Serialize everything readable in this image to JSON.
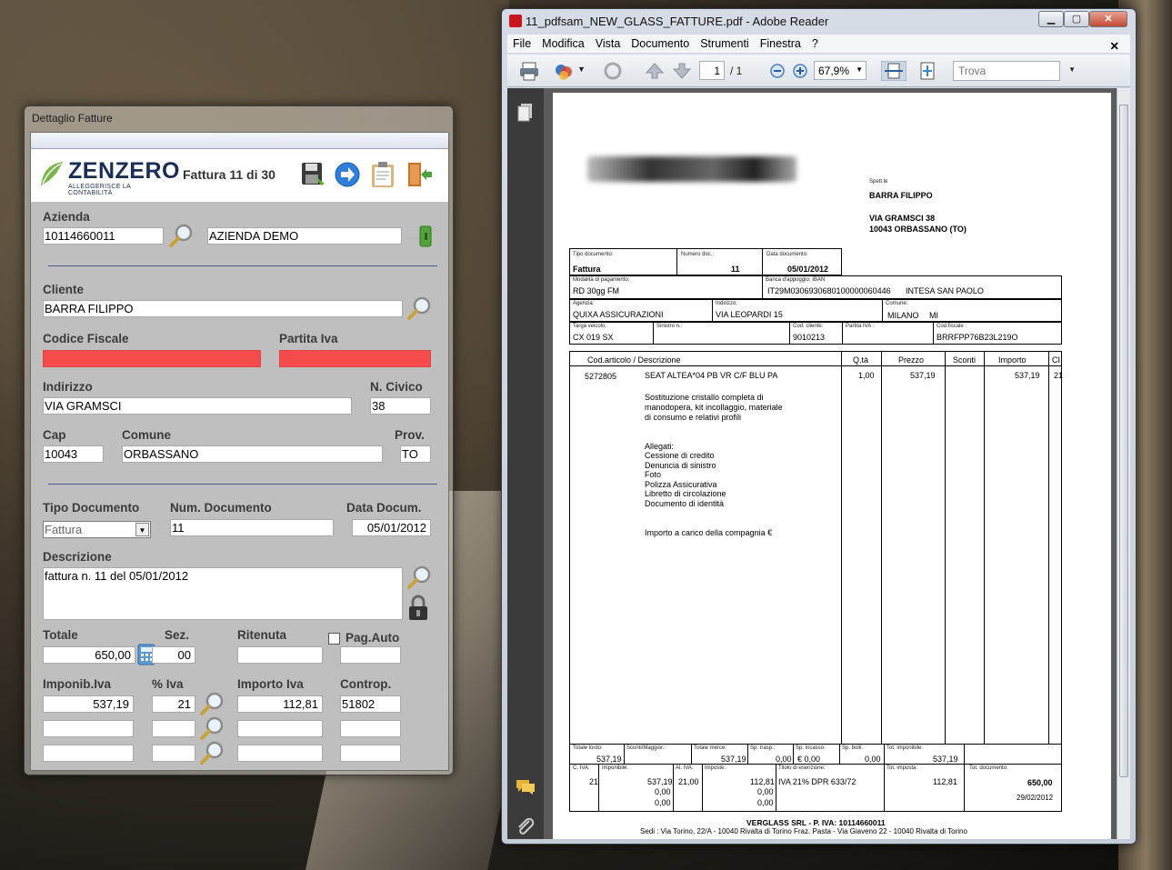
{
  "left_window": {
    "title": "Dettaglio Fatture",
    "logo": {
      "name": "ZENZERO",
      "tagline": "ALLEGGERISCE LA CONTABILITÀ"
    },
    "counter": "Fattura 11 di 30",
    "azienda": {
      "label": "Azienda",
      "code": "10114660011",
      "name": "AZIENDA DEMO"
    },
    "cliente": {
      "label": "Cliente",
      "value": "BARRA FILIPPO"
    },
    "codice_fiscale": {
      "label": "Codice Fiscale",
      "value": ""
    },
    "partita_iva": {
      "label": "Partita Iva",
      "value": ""
    },
    "indirizzo": {
      "label": "Indirizzo",
      "value": "VIA GRAMSCI"
    },
    "civico": {
      "label": "N. Civico",
      "value": "38"
    },
    "cap": {
      "label": "Cap",
      "value": "10043"
    },
    "comune": {
      "label": "Comune",
      "value": "ORBASSANO"
    },
    "prov": {
      "label": "Prov.",
      "value": "TO"
    },
    "tipo_documento": {
      "label": "Tipo Documento",
      "value": "Fattura"
    },
    "num_documento": {
      "label": "Num. Documento",
      "value": "11"
    },
    "data_documento": {
      "label": "Data Docum.",
      "value": "05/01/2012"
    },
    "descrizione": {
      "label": "Descrizione",
      "value": "fattura n. 11 del 05/01/2012"
    },
    "totale": {
      "label": "Totale",
      "value": "650,00"
    },
    "sez": {
      "label": "Sez.",
      "value": "00"
    },
    "ritenuta": {
      "label": "Ritenuta",
      "value": ""
    },
    "pag_auto": {
      "label": "Pag.Auto",
      "value": ""
    },
    "iva_headers": {
      "imponib": "Imponib.Iva",
      "perc": "% Iva",
      "importo": "Importo Iva",
      "controp": "Controp."
    },
    "iva_rows": [
      {
        "imponib": "537,19",
        "perc": "21",
        "importo": "112,81",
        "controp": "51802"
      },
      {
        "imponib": "",
        "perc": "",
        "importo": "",
        "controp": ""
      },
      {
        "imponib": "",
        "perc": "",
        "importo": "",
        "controp": ""
      }
    ]
  },
  "right_window": {
    "title": "11_pdfsam_NEW_GLASS_FATTURE.pdf - Adobe Reader",
    "menu": [
      "File",
      "Modifica",
      "Vista",
      "Documento",
      "Strumenti",
      "Finestra",
      "?"
    ],
    "page_current": "1",
    "page_total": "/ 1",
    "zoom": "67,9%",
    "find_placeholder": "Trova",
    "pdf": {
      "spett": "Spett.le",
      "dest_name": "BARRA FILIPPO",
      "dest_street": "VIA GRAMSCI 38",
      "dest_city": "10043 ORBASSANO (TO)",
      "tipo_doc_lbl": "Tipo documento:",
      "tipo_doc": "Fattura",
      "num_doc_lbl": "Numero doc.:",
      "num_doc": "11",
      "data_doc_lbl": "Data documento:",
      "data_doc": "05/01/2012",
      "mod_pag_lbl": "Modalità di pagamento:",
      "mod_pag": "RD 30gg FM",
      "banca_lbl": "Banca d'appoggio: IBAN",
      "iban": "IT29M0306930680100000060446",
      "banca": "INTESA SAN PAOLO",
      "agenzia_lbl": "Agenzia:",
      "agenzia": "QUIXA ASSICURAZIONI",
      "indirizzo_lbl": "Indirizzo:",
      "indirizzo": "VIA LEOPARDI 15",
      "comune_lbl": "Comune:",
      "comune": "MILANO",
      "prov": "MI",
      "targa_lbl": "Targa veicolo:",
      "targa": "CX 019 SX",
      "sinistro_lbl": "Sinistro n.:",
      "cod_cliente_lbl": "Cod. cliente:",
      "cod_cliente": "9010213",
      "piva_lbl": "Partita IVA :",
      "cf_lbl": "Cod.fiscale :",
      "cf": "BRRFPP76B23L219O",
      "cols": [
        "Cod.articolo / Descrizione",
        "Q.tà",
        "Prezzo",
        "Sconti",
        "Importo",
        "CI"
      ],
      "line_code": "5272805",
      "line_desc": "SEAT ALTEA*04 PB VR C/F BLU PA",
      "line_qty": "1,00",
      "line_price": "537,19",
      "line_amount": "537,19",
      "line_ci": "21",
      "desc_lines": [
        "Sostituzione cristallo completa di",
        "manodopera, kit incollaggio, materiale",
        "di consumo e relativi profili"
      ],
      "allegati": [
        "Allegati:",
        "Cessione di credito",
        "Denuncia di sinistro",
        "Foto",
        "Polizza Assicurativa",
        "Libretto di circolazione",
        "Documento di identità"
      ],
      "importo_note": "Importo a carico della compagnia €",
      "tot_lordo_lbl": "Totale lordo:",
      "tot_lordo": "537,19",
      "sconti_lbl": "Sconti/Maggior.:",
      "tot_merce_lbl": "Totale merce:",
      "tot_merce": "537,19",
      "sp_trasp_lbl": "Sp. trasp.:",
      "sp_trasp": "0,00",
      "sp_incasso_lbl": "Sp. incasso:",
      "sp_incasso": "€      0,00",
      "sp_bolli_lbl": "Sp. bolli:",
      "sp_bolli": "0,00",
      "tot_imponibile_lbl": "Tot. imponibile:",
      "tot_imponibile": "537,19",
      "c_iva_lbl": "C. IVA:",
      "c_iva": "21",
      "imponibile_lbl": "Imponibile:",
      "imponibili": [
        "537,19",
        "0,00",
        "0,00"
      ],
      "al_iva_lbl": "Al. IVA:",
      "al_iva": "21,00",
      "imposte_lbl": "Imposte:",
      "imposte": [
        "112,81",
        "0,00",
        "0,00"
      ],
      "esenzione_lbl": "Titolo di esenzione:",
      "esenzione": "IVA 21% DPR 633/72",
      "tot_imposta_lbl": "Tot. imposta:",
      "tot_imposta": "112,81",
      "tot_doc_lbl": "Tot. documento:",
      "tot_doc": "650,00",
      "tot_doc_date": "29/02/2012",
      "footer1": "VERGLASS SRL - P. IVA: 10114660011",
      "footer2": "Sedi :  Via Torino, 22/A - 10040 Rivalta di Torino Fraz. Pasta  -  Via Giaveno 22 - 10040 Rivalta di Torino"
    }
  },
  "colors": {
    "required_field": "#f64b4b",
    "divider": "#4e5a8e",
    "logo": "#1a2d55"
  }
}
